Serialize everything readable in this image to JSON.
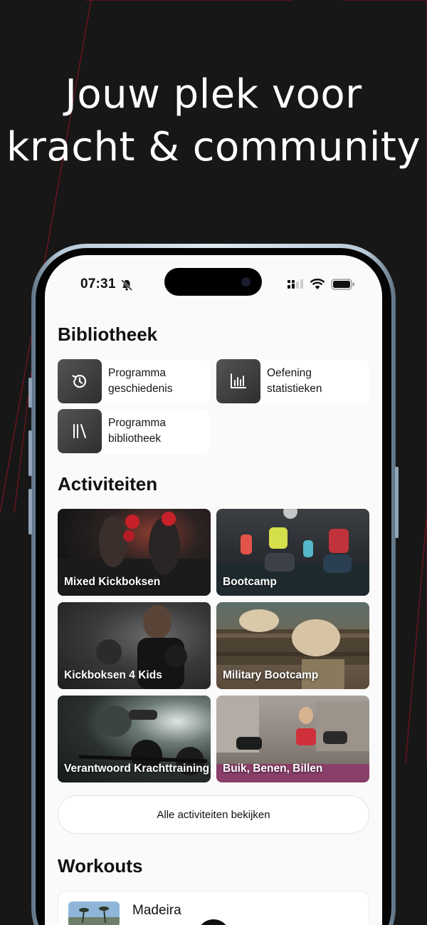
{
  "headline": {
    "line1": "Jouw plek voor",
    "line2": "kracht & community"
  },
  "status_bar": {
    "time": "07:31"
  },
  "library": {
    "title": "Bibliotheek",
    "items": [
      {
        "line1": "Programma",
        "line2": "geschiedenis",
        "icon": "history-icon"
      },
      {
        "line1": "Oefening",
        "line2": "statistieken",
        "icon": "bar-chart-icon"
      },
      {
        "line1": "Programma",
        "line2": "bibliotheek",
        "icon": "books-icon"
      }
    ]
  },
  "activities": {
    "title": "Activiteiten",
    "items": [
      {
        "label": "Mixed Kickboksen"
      },
      {
        "label": "Bootcamp"
      },
      {
        "label": "Kickboksen 4 Kids"
      },
      {
        "label": "Military Bootcamp"
      },
      {
        "label": "Verantwoord Krachttraining"
      },
      {
        "label": "Buik, Benen, Billen"
      }
    ],
    "view_all_label": "Alle activiteiten bekijken"
  },
  "workouts": {
    "title": "Workouts",
    "items": [
      {
        "title": "Madeira"
      }
    ]
  },
  "colors": {
    "background": "#171717",
    "accent_line": "#7a1420",
    "screen": "#fafafa"
  }
}
